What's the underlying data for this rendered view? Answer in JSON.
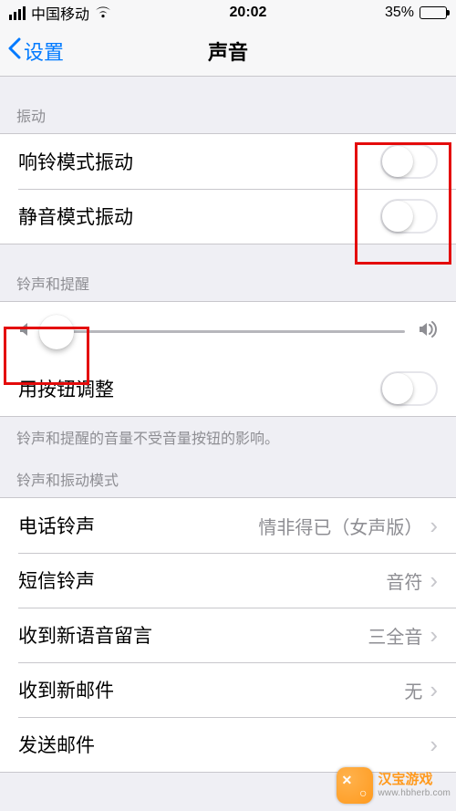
{
  "status_bar": {
    "carrier": "中国移动",
    "time": "20:02",
    "battery_percent_text": "35%",
    "battery_fill_percent": 35
  },
  "nav": {
    "back_label": "设置",
    "title": "声音"
  },
  "sections": {
    "vibration_header": "振动",
    "ringer_header": "铃声和提醒",
    "pattern_header": "铃声和振动模式"
  },
  "toggles": {
    "vibrate_on_ring": {
      "label": "响铃模式振动",
      "on": false
    },
    "vibrate_on_silent": {
      "label": "静音模式振动",
      "on": false
    },
    "change_with_buttons": {
      "label": "用按钮调整",
      "on": false
    }
  },
  "slider": {
    "value_percent": 3
  },
  "footer_text": "铃声和提醒的音量不受音量按钮的影响。",
  "rows": {
    "ringtone": {
      "label": "电话铃声",
      "value": "情非得已（女声版）"
    },
    "text_tone": {
      "label": "短信铃声",
      "value": "音符"
    },
    "new_voicemail": {
      "label": "收到新语音留言",
      "value": "三全音"
    },
    "new_mail": {
      "label": "收到新邮件",
      "value": "无"
    },
    "sent_mail": {
      "label": "发送邮件",
      "value": ""
    }
  },
  "watermark": {
    "title": "汉宝游戏",
    "url": "www.hbherb.com"
  },
  "colors": {
    "highlight": "#e40b0b",
    "ios_blue": "#007aff"
  }
}
